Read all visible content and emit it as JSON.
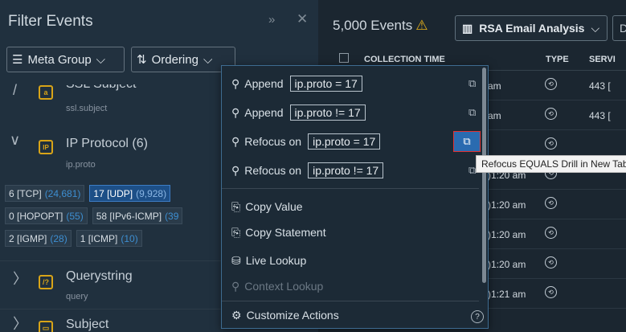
{
  "filter_panel": {
    "title": "Filter Events",
    "collapse_icon": "double-chevron-right-icon",
    "close_icon": "close-icon",
    "meta_group_label": "Meta Group",
    "ordering_label": "Ordering",
    "meta_keys": [
      {
        "title": "SSL Subject",
        "key": "ssl.subject",
        "icon": "lock-icon",
        "icon_glyph": "a"
      },
      {
        "title": "IP Protocol (6)",
        "key": "ip.proto",
        "icon": "ip-icon",
        "icon_glyph": "IP"
      },
      {
        "title": "Querystring",
        "key": "query",
        "icon": "query-icon",
        "icon_glyph": "/?"
      },
      {
        "title": "Subject",
        "key": "",
        "icon": "subject-icon",
        "icon_glyph": "▭"
      }
    ],
    "values": [
      {
        "label": "6 [TCP]",
        "count": "(24,681)"
      },
      {
        "label": "17 [UDP]",
        "count": "(9,928)"
      },
      {
        "label": "0 [HOPOPT]",
        "count": "(55)"
      },
      {
        "label": "58 [IPv6-ICMP]",
        "count": "(39"
      },
      {
        "label": "2 [IGMP]",
        "count": "(28)"
      },
      {
        "label": "1 [ICMP]",
        "count": "(10)"
      }
    ]
  },
  "events_panel": {
    "count_label": "5,000 Events",
    "profile_label": "RSA Email Analysis",
    "second_dropdown_label": "De",
    "columns": {
      "collection_time": "COLLECTION TIME",
      "type": "TYPE",
      "service": "SERVI"
    },
    "rows": [
      {
        "time": "am",
        "service": "443 ["
      },
      {
        "time": "am",
        "service": "443 ["
      },
      {
        "time": "",
        "service": ""
      },
      {
        "time": ")1:20 am",
        "service": ""
      },
      {
        "time": ")1:20 am",
        "service": ""
      },
      {
        "time": ")1:20 am",
        "service": ""
      },
      {
        "time": ")1:20 am",
        "service": ""
      },
      {
        "time": ")1:21 am",
        "service": ""
      }
    ]
  },
  "context_menu": {
    "items": [
      {
        "verb": "Append",
        "expr": "ip.proto = 17"
      },
      {
        "verb": "Append",
        "expr": "ip.proto != 17"
      },
      {
        "verb": "Refocus on",
        "expr": "ip.proto = 17"
      },
      {
        "verb": "Refocus on",
        "expr": "ip.proto != 17"
      }
    ],
    "copy_value": "Copy Value",
    "copy_statement": "Copy Statement",
    "live_lookup": "Live Lookup",
    "context_lookup": "Context Lookup",
    "customize_actions": "Customize Actions",
    "tooltip": "Refocus EQUALS Drill in New Tab"
  },
  "colors": {
    "accent": "#2a6bb0",
    "warning": "#e8b21b",
    "selected_value": "#1d4f87",
    "highlight_border": "#e23232"
  }
}
